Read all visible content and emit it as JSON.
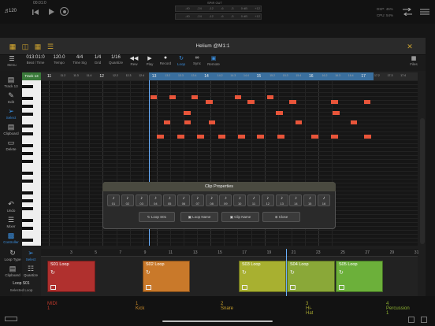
{
  "status": {
    "volume": "120",
    "time": "00:01:0",
    "spir_out": "SPIR OUT",
    "db": "-5 dB",
    "dsp": "DSP: 46%",
    "cpu": "CPU: 54%"
  },
  "meter_labels": [
    "-40",
    "-24",
    "-12",
    "-6",
    "-3",
    "0 dB",
    "+12",
    "-40",
    "-24",
    "-12",
    "-6",
    "-3",
    "0 dB",
    "+12"
  ],
  "editor": {
    "title": "Helium @M1:1",
    "files_label": "Files",
    "track_label": "Track 13"
  },
  "transport": {
    "menu": "Menu",
    "position": "013:01:0",
    "position_label": "Beat / Time",
    "tempo": "120.0",
    "tempo_label": "Tempo",
    "timesig": "4/4",
    "timesig_label": "Time Sig",
    "grid": "1/4",
    "grid_label": "Grid",
    "quantize": "1/16",
    "quantize_label": "Quantize",
    "rew": "Rew",
    "play": "Play",
    "record": "Record",
    "loop": "Loop",
    "sync": "Sync",
    "remote": "Remote"
  },
  "sidebar": [
    "Track 13",
    "Edit",
    "Select",
    "Clipboard",
    "Delete",
    "Undo",
    "Mixer",
    "Controller"
  ],
  "lower_sidebar": {
    "loop_type": "Loop Type",
    "select": "Select",
    "clipboard": "Clipboard",
    "quantize": "Quantize",
    "loop_name": "Loop S01",
    "selected_loop": "Selected Loop"
  },
  "ruler": [
    "11",
    "11.2",
    "11.3",
    "11.4",
    "12",
    "12.2",
    "12.3",
    "12.4",
    "13",
    "13.2",
    "13.3",
    "13.4",
    "14",
    "14.2",
    "14.3",
    "14.4",
    "15",
    "15.2",
    "15.3",
    "15.4",
    "16",
    "16.2",
    "16.3",
    "16.4",
    "17",
    "17.2",
    "17.3",
    "17.4"
  ],
  "dialog": {
    "title": "Clip Properties",
    "slots": [
      "01",
      "02",
      "03",
      "04",
      "05",
      "06",
      "07",
      "08",
      "09",
      "10",
      "11",
      "12",
      "13",
      "14",
      "15",
      "16"
    ],
    "loop": "Loop S01",
    "loop_name": "Loop Name",
    "clip_name": "Clip Name",
    "close": "Close"
  },
  "timeline": [
    "3",
    "5",
    "7",
    "9",
    "11",
    "13",
    "15",
    "17",
    "19",
    "21",
    "23",
    "25",
    "27",
    "29",
    "31"
  ],
  "clips": [
    {
      "label": "S01 Loop",
      "color": "#b0302e"
    },
    {
      "label": "S02 Loop",
      "color": "#c9792a"
    },
    {
      "label": "S03 Loop",
      "color": "#a8b030"
    },
    {
      "label": "S04 Loop",
      "color": "#8aa838"
    },
    {
      "label": "S05 Loop",
      "color": "#6cb03a"
    }
  ],
  "tracks": [
    {
      "name": "MIDI 1",
      "color": "#c0392b"
    },
    {
      "name": "1 Kick",
      "color": "#c98a2a"
    },
    {
      "name": "2 Snare",
      "color": "#c9a02a"
    },
    {
      "name": "3 Hi-Hat",
      "color": "#a8a830"
    },
    {
      "name": "4 Percussion 1",
      "color": "#8cb030"
    }
  ]
}
